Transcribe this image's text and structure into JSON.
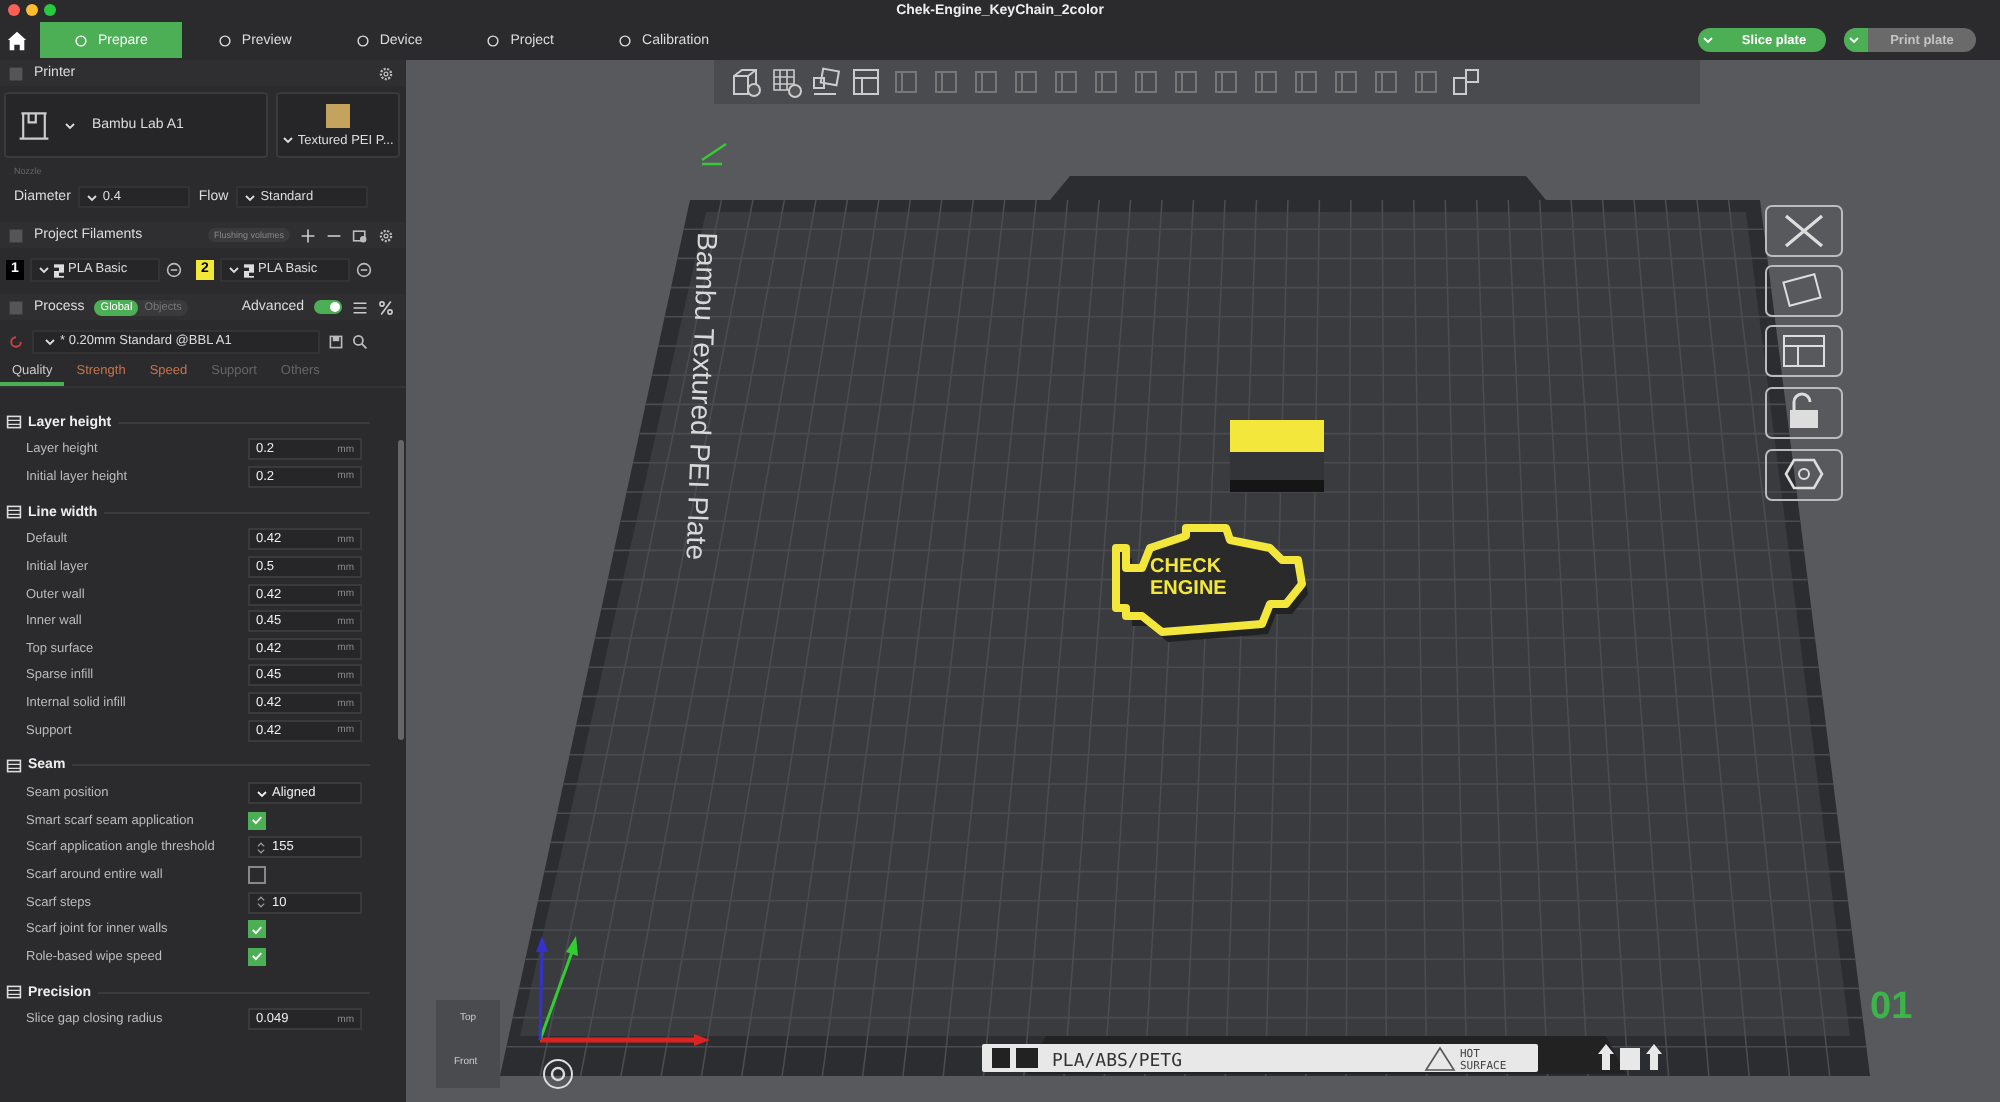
{
  "window": {
    "title": "Chek-Engine_KeyChain_2color"
  },
  "tabs": [
    {
      "label": "Prepare",
      "selected": true
    },
    {
      "label": "Preview",
      "selected": false
    },
    {
      "label": "Device",
      "selected": false
    },
    {
      "label": "Project",
      "selected": false
    },
    {
      "label": "Calibration",
      "selected": false
    }
  ],
  "actions": [
    {
      "label": "Slice plate",
      "disabled": false
    },
    {
      "label": "Print plate",
      "disabled": true
    }
  ],
  "printer": {
    "heading": "Printer",
    "name": "Bambu Lab A1",
    "plate": "Textured PEI P...",
    "nozzle_label": "Nozzle",
    "diameter_label": "Diameter",
    "diameter": "0.4",
    "flow_label": "Flow",
    "flow": "Standard"
  },
  "filaments": {
    "heading": "Project Filaments",
    "flushing": "Flushing volumes",
    "items": [
      {
        "index": "1",
        "name": "PLA Basic",
        "color": "#000000"
      },
      {
        "index": "2",
        "name": "PLA Basic",
        "color": "#f2e83a"
      }
    ]
  },
  "process": {
    "heading": "Process",
    "scopes": [
      {
        "label": "Global",
        "selected": true
      },
      {
        "label": "Objects",
        "selected": false
      }
    ],
    "advanced_label": "Advanced",
    "advanced": true,
    "preset": "* 0.20mm Standard @BBL A1"
  },
  "setting_tabs": [
    {
      "label": "Quality",
      "selected": true,
      "modified": false
    },
    {
      "label": "Strength",
      "selected": false,
      "modified": true
    },
    {
      "label": "Speed",
      "selected": false,
      "modified": true
    },
    {
      "label": "Support",
      "selected": false,
      "modified": false
    },
    {
      "label": "Others",
      "selected": false,
      "modified": false
    }
  ],
  "sections": [
    {
      "title": "Layer height",
      "rows": [
        {
          "kind": "number",
          "label": "Layer height",
          "value": "0.2",
          "unit": "mm"
        },
        {
          "kind": "number",
          "label": "Initial layer height",
          "value": "0.2",
          "unit": "mm"
        }
      ]
    },
    {
      "title": "Line width",
      "rows": [
        {
          "kind": "number",
          "label": "Default",
          "value": "0.42",
          "unit": "mm"
        },
        {
          "kind": "number",
          "label": "Initial layer",
          "value": "0.5",
          "unit": "mm"
        },
        {
          "kind": "number",
          "label": "Outer wall",
          "value": "0.42",
          "unit": "mm"
        },
        {
          "kind": "number",
          "label": "Inner wall",
          "value": "0.45",
          "unit": "mm"
        },
        {
          "kind": "number",
          "label": "Top surface",
          "value": "0.42",
          "unit": "mm"
        },
        {
          "kind": "number",
          "label": "Sparse infill",
          "value": "0.45",
          "unit": "mm"
        },
        {
          "kind": "number",
          "label": "Internal solid infill",
          "value": "0.42",
          "unit": "mm"
        },
        {
          "kind": "number",
          "label": "Support",
          "value": "0.42",
          "unit": "mm"
        }
      ]
    },
    {
      "title": "Seam",
      "rows": [
        {
          "kind": "select",
          "label": "Seam position",
          "value": "Aligned"
        },
        {
          "kind": "checkbox",
          "label": "Smart scarf seam application",
          "checked": true
        },
        {
          "kind": "spin",
          "label": "Scarf application angle threshold",
          "value": "155"
        },
        {
          "kind": "checkbox",
          "label": "Scarf around entire wall",
          "checked": false
        },
        {
          "kind": "spin",
          "label": "Scarf steps",
          "value": "10"
        },
        {
          "kind": "checkbox",
          "label": "Scarf joint for inner walls",
          "checked": true
        },
        {
          "kind": "checkbox",
          "label": "Role-based wipe speed",
          "checked": true
        }
      ]
    },
    {
      "title": "Precision",
      "rows": [
        {
          "kind": "number",
          "label": "Slice gap closing radius",
          "value": "0.049",
          "unit": "mm"
        }
      ]
    }
  ],
  "viewport": {
    "plate_label": "Bambu Textured PEI Plate",
    "model_text": [
      "CHECK",
      "ENGINE"
    ],
    "plate_material": "PLA/ABS/PETG",
    "warning": [
      "HOT",
      "SURFACE"
    ],
    "plate_number": "01",
    "cube_faces": [
      "Top",
      "Front"
    ]
  }
}
